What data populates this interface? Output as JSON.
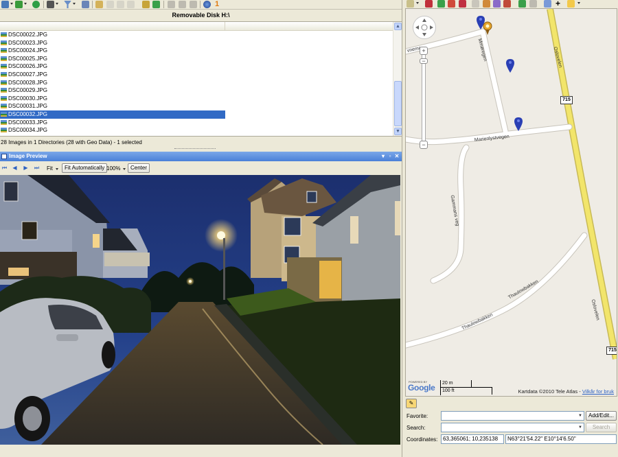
{
  "file_panel": {
    "title": "Removable Disk H:\\",
    "files": [
      "DSC00022.JPG",
      "DSC00023.JPG",
      "DSC00024.JPG",
      "DSC00025.JPG",
      "DSC00026.JPG",
      "DSC00027.JPG",
      "DSC00028.JPG",
      "DSC00029.JPG",
      "DSC00030.JPG",
      "DSC00031.JPG",
      "DSC00032.JPG",
      "DSC00033.JPG",
      "DSC00034.JPG"
    ],
    "selected_file": "DSC00032.JPG",
    "status": "28 Images in 1 Directories (28 with Geo Data) - 1 selected"
  },
  "preview": {
    "title": "Image Preview",
    "fit_label": "Fit",
    "fit_auto_label": "Fit Automatically",
    "zoom_value": "100%",
    "center_label": "Center"
  },
  "map": {
    "roads": {
      "oslovegen_top": "Oslovelen",
      "oslovegen_bottom": "Oslovelen",
      "marienlyst": "Marienlystvegen",
      "gammans": "Gammans veg",
      "thaulow_1": "Thaulowbakken",
      "thaulow_2": "Thaulowbakken",
      "mmoregen": "Mmøregen",
      "vnemo": "vnemo"
    },
    "route_shields": [
      "715",
      "715"
    ],
    "scale_metric": "20 m",
    "scale_imperial": "100 ft",
    "powered_by": "POWERED BY",
    "logo_text": "Google",
    "attribution": "Kartdata ©2010 Tele Atlas -",
    "terms_link": "Vilkår for bruk"
  },
  "geo_panel": {
    "favorite_label": "Favorite:",
    "favorite_value": "",
    "add_edit_label": "Add/Edit...",
    "search_label": "Search:",
    "search_value": "",
    "search_button": "Search",
    "coordinates_label": "Coordinates:",
    "coordinates_decimal": "63,365061; 10,235138",
    "coordinates_dms": "N63°21'54.22\" E10°14'6.50\""
  },
  "colors": {
    "selection": "#316ac5",
    "titlebar": "#4a80d8",
    "highway": "#f2e56b"
  }
}
